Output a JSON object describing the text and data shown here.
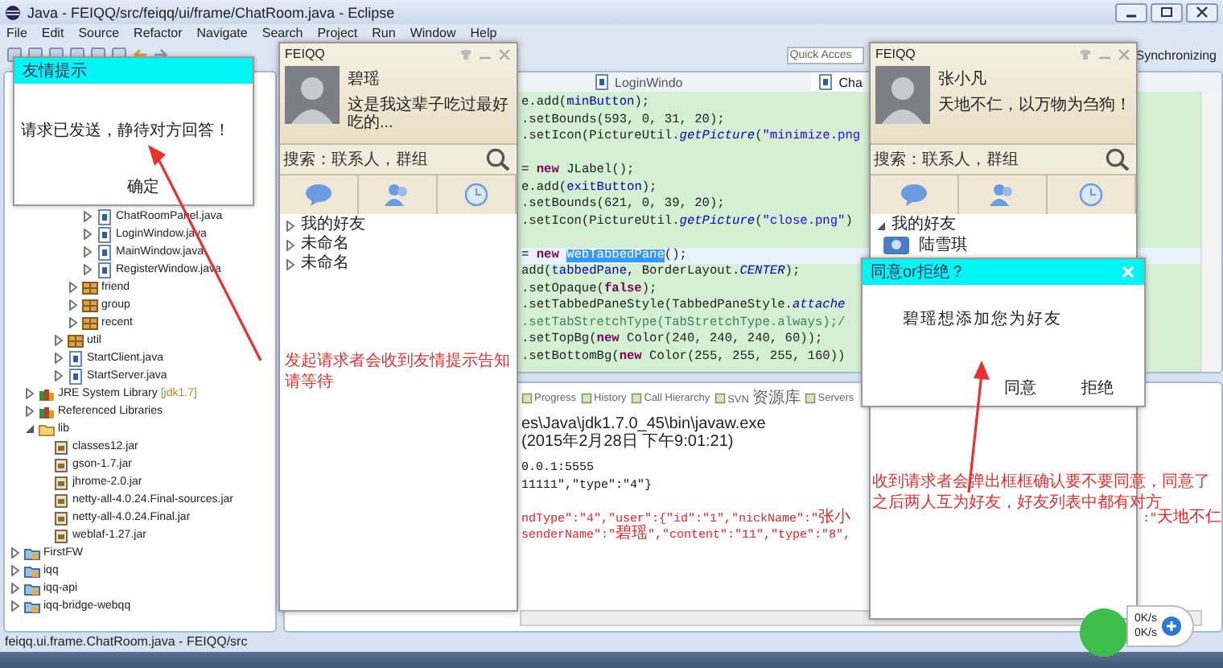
{
  "window": {
    "title": "Java - FEIQQ/src/feiqq/ui/frame/ChatRoom.java - Eclipse"
  },
  "menu": [
    "File",
    "Edit",
    "Source",
    "Refactor",
    "Navigate",
    "Search",
    "Project",
    "Run",
    "Window",
    "Help"
  ],
  "toolbar": {
    "quick_access": {
      "placeholder": "Quick Acces"
    },
    "perspective": "Synchronizing"
  },
  "package_explorer": {
    "tree": [
      {
        "children": [
          {
            "children": [
              {
                "children": [
                  {
                    "children": [
                      {
                        "children": [
                          {
                            "label": "ChatRoomPanel.java",
                            "kind": "file",
                            "expanded": false
                          },
                          {
                            "label": "LoginWindow.java",
                            "kind": "file",
                            "expanded": false
                          },
                          {
                            "label": "MainWindow.java",
                            "kind": "file",
                            "expanded": false
                          },
                          {
                            "label": "RegisterWindow.java",
                            "kind": "file",
                            "expanded": false
                          }
                        ]
                      },
                      {
                        "label": "friend",
                        "kind": "package",
                        "expanded": false
                      },
                      {
                        "label": "group",
                        "kind": "package",
                        "expanded": false
                      },
                      {
                        "label": "recent",
                        "kind": "package",
                        "expanded": false
                      }
                    ]
                  },
                  {
                    "label": "util",
                    "kind": "package",
                    "expanded": false
                  },
                  {
                    "label": "StartClient.java",
                    "kind": "file",
                    "expanded": false
                  },
                  {
                    "label": "StartServer.java",
                    "kind": "file",
                    "expanded": false
                  }
                ]
              }
            ]
          },
          {
            "label": "JRE System Library",
            "decoration": "[jdk1.7]",
            "kind": "library",
            "expanded": false
          },
          {
            "label": "Referenced Libraries",
            "kind": "library",
            "expanded": false
          },
          {
            "label": "lib",
            "kind": "folder",
            "expanded": true,
            "children": [
              {
                "label": "classes12.jar",
                "kind": "jar"
              },
              {
                "label": "gson-1.7.jar",
                "kind": "jar"
              },
              {
                "label": "jhrome-2.0.jar",
                "kind": "jar"
              },
              {
                "label": "netty-all-4.0.24.Final-sources.jar",
                "kind": "jar"
              },
              {
                "label": "netty-all-4.0.24.Final.jar",
                "kind": "jar"
              },
              {
                "label": "weblaf-1.27.jar",
                "kind": "jar"
              }
            ]
          }
        ]
      },
      {
        "label": "FirstFW",
        "kind": "project",
        "expanded": false
      },
      {
        "label": "iqq",
        "kind": "project",
        "expanded": false
      },
      {
        "label": "iqq-api",
        "kind": "project",
        "expanded": false
      },
      {
        "label": "iqq-bridge-webqq",
        "kind": "project",
        "expanded": false
      }
    ]
  },
  "editor": {
    "tabs": [
      {
        "label": "LoginWindo",
        "selected": false
      },
      {
        "label": "Cha",
        "selected": true
      }
    ],
    "lines": [
      {
        "current": false,
        "segments": [
          {
            "kind": "plain",
            "text": "e.add("
          },
          {
            "kind": "field",
            "text": "minButton"
          },
          {
            "kind": "plain",
            "text": ");"
          }
        ]
      },
      {
        "current": false,
        "segments": [
          {
            "kind": "plain",
            "text": ".setBounds(593, 0, 31, 20);"
          }
        ]
      },
      {
        "current": false,
        "segments": [
          {
            "kind": "plain",
            "text": ".setIcon(PictureUtil."
          },
          {
            "kind": "static",
            "text": "getPicture"
          },
          {
            "kind": "plain",
            "text": "("
          },
          {
            "kind": "string",
            "text": "\"minimize.png"
          }
        ]
      },
      {
        "current": false
      },
      {
        "current": false,
        "segments": [
          {
            "kind": "plain",
            "text": "= "
          },
          {
            "kind": "keyword",
            "text": "new"
          },
          {
            "kind": "plain",
            "text": " JLabel();"
          }
        ]
      },
      {
        "current": false,
        "segments": [
          {
            "kind": "plain",
            "text": "e.add("
          },
          {
            "kind": "field",
            "text": "exitButton"
          },
          {
            "kind": "plain",
            "text": ");"
          }
        ]
      },
      {
        "current": false,
        "segments": [
          {
            "kind": "plain",
            "text": ".setBounds(621, 0, 39, 20);"
          }
        ]
      },
      {
        "current": false,
        "segments": [
          {
            "kind": "plain",
            "text": ".setIcon(PictureUtil."
          },
          {
            "kind": "static",
            "text": "getPicture"
          },
          {
            "kind": "plain",
            "text": "("
          },
          {
            "kind": "string",
            "text": "\"close.png\""
          },
          {
            "kind": "plain",
            "text": ")"
          }
        ]
      },
      {
        "current": false
      },
      {
        "current": true,
        "segments": [
          {
            "kind": "plain",
            "text": "= "
          },
          {
            "kind": "keyword",
            "text": "new "
          },
          {
            "kind": "selection",
            "text": "WebTabbedPane"
          },
          {
            "kind": "plain",
            "text": "();"
          }
        ]
      },
      {
        "current": false,
        "segments": [
          {
            "kind": "plain",
            "text": "add("
          },
          {
            "kind": "field",
            "text": "tabbedPane"
          },
          {
            "kind": "plain",
            "text": ", BorderLayout."
          },
          {
            "kind": "static",
            "text": "CENTER"
          },
          {
            "kind": "plain",
            "text": ");"
          }
        ]
      },
      {
        "current": false,
        "segments": [
          {
            "kind": "plain",
            "text": ".setOpaque("
          },
          {
            "kind": "keyword",
            "text": "false"
          },
          {
            "kind": "plain",
            "text": ");"
          }
        ]
      },
      {
        "current": false,
        "segments": [
          {
            "kind": "plain",
            "text": ".setTabbedPaneStyle(TabbedPaneStyle."
          },
          {
            "kind": "static",
            "text": "attache"
          }
        ]
      },
      {
        "current": false,
        "segments": [
          {
            "kind": "comment",
            "text": ".setTabStretchType(TabStretchType.always);/"
          }
        ]
      },
      {
        "current": false,
        "segments": [
          {
            "kind": "plain",
            "text": ".setTopBg("
          },
          {
            "kind": "keyword",
            "text": "new"
          },
          {
            "kind": "plain",
            "text": " Color(240, 240, 240, 60));"
          }
        ]
      },
      {
        "current": false,
        "segments": [
          {
            "kind": "plain",
            "text": ".setBottomBg("
          },
          {
            "kind": "keyword",
            "text": "new"
          },
          {
            "kind": "plain",
            "text": " Color(255, 255, 255, 160))"
          }
        ]
      }
    ]
  },
  "console": {
    "views": [
      "Progress",
      "History",
      "Call Hierarchy",
      "SVN 资源库",
      "Servers"
    ],
    "path": "es\\Java\\jdk1.7.0_45\\bin\\javaw.exe (2015年2月28日 下午9:01:21)",
    "lines": [
      {
        "kind": "output",
        "text": "0.0.1:5555"
      },
      {
        "kind": "output",
        "text": "11111\",\"type\":\"4\"}"
      },
      {
        "kind": "blank"
      },
      {
        "kind": "error",
        "text": "ndType\":\"4\",\"user\":{\"id\":\"1\",\"nickName\":\"张小",
        "tail": ":\"天地不仁"
      },
      {
        "kind": "error",
        "text": "senderName\":\"碧瑶\",\"content\":\"11\",\"type\":\"8\","
      }
    ]
  },
  "status_bar": "feiqq.ui.frame.ChatRoom.java - FEIQQ/src",
  "qq_windows": [
    {
      "title": "FEIQQ",
      "name": "碧瑶",
      "signature": "这是我这辈子吃过最好吃的...",
      "search": {
        "placeholder": "搜索：联系人，群组"
      },
      "groups": [
        {
          "label": "我的好友",
          "expanded": false
        },
        {
          "label": "未命名",
          "expanded": false
        },
        {
          "label": "未命名",
          "expanded": false
        }
      ]
    },
    {
      "title": "FEIQQ",
      "name": "张小凡",
      "signature": "天地不仁，以万物为刍狗！",
      "search": {
        "placeholder": "搜索：联系人，群组"
      },
      "groups": [
        {
          "label": "我的好友",
          "expanded": true,
          "friends": [
            {
              "name": "陆雪琪"
            }
          ]
        }
      ]
    }
  ],
  "dialogs": [
    {
      "kind": "notice",
      "title": "友情提示",
      "message": "请求已发送，静待对方回答！",
      "buttons": [
        "确定"
      ]
    },
    {
      "kind": "confirm",
      "title": "同意or拒绝？",
      "message": "碧瑶想添加您为好友",
      "buttons": [
        "同意",
        "拒绝"
      ]
    }
  ],
  "annotations": [
    "发起请求者会收到友情提示告知请等待",
    "收到请求者会弹出框框确认要不要同意，同意了之后两人互为好友，好友列表中都有对方"
  ],
  "speed": [
    "0K/s",
    "0K/s"
  ]
}
